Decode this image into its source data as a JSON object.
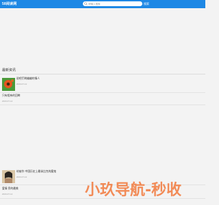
{
  "header": {
    "logo_text": "58阅读网",
    "search_placeholder": "请输入搜索",
    "search_button": "搜索"
  },
  "section": {
    "title": "最新资讯"
  },
  "news": [
    {
      "title": "说吧厅啲编编的情人",
      "date": "2023-07-12"
    },
    {
      "title": "只有相亲的回眸",
      "date": "2023-07-12"
    },
    {
      "title": "给被作 中国历史上最拿比克的魔鬼",
      "date": "2023-07-12"
    },
    {
      "title": "爱情 旁的最美",
      "date": "2023-07-12"
    }
  ],
  "watermark": {
    "text": "小玖导航-秒收"
  },
  "colors": {
    "header_bg": "#1e88e5",
    "page_bg": "#f3f3f3",
    "watermark": "#f27a3c"
  }
}
